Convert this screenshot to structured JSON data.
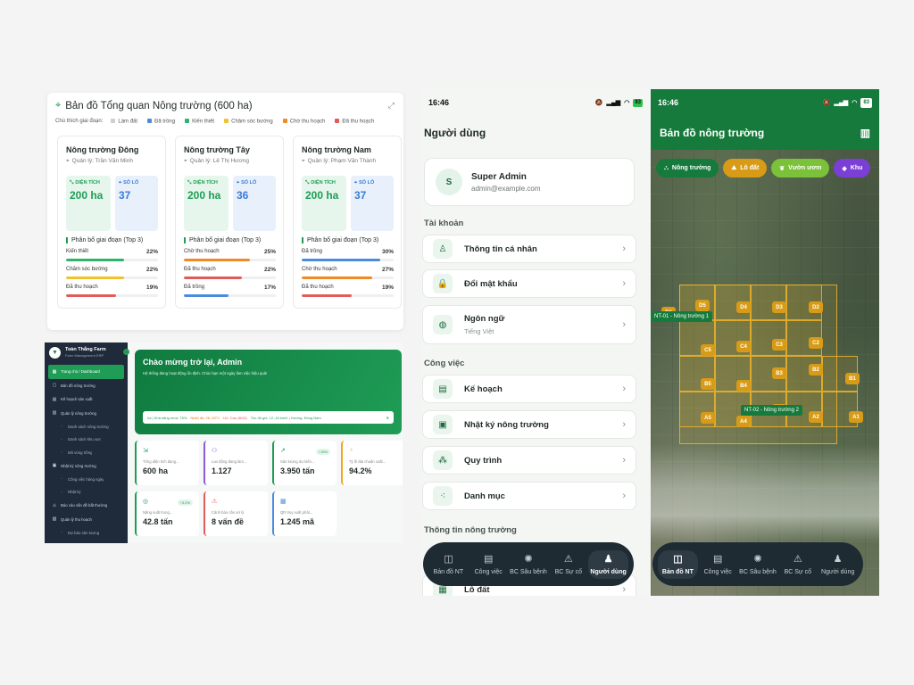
{
  "overview": {
    "title": "Bản đồ Tổng quan Nông trường (600 ha)",
    "legend_label": "Chú thích giai đoạn:",
    "legend": [
      {
        "label": "Làm đất",
        "color": "#c9cfd4"
      },
      {
        "label": "Đã trồng",
        "color": "#4a8be0"
      },
      {
        "label": "Kiến thiết",
        "color": "#2fb36a"
      },
      {
        "label": "Chăm sóc bướng",
        "color": "#f2c12e"
      },
      {
        "label": "Chờ thu hoạch",
        "color": "#f08a24"
      },
      {
        "label": "Đã thu hoạch",
        "color": "#e25b5b"
      }
    ],
    "farms": [
      {
        "name": "Nông trường Đông",
        "manager": "Quản lý: Trần Văn Minh",
        "area_label": "DIỆN TÍCH",
        "area": "200 ha",
        "plots_label": "SỐ LÔ",
        "plots": "37",
        "dist_title": "Phân bổ giai đoạn (Top 3)",
        "rows": [
          {
            "label": "Kiến thiết",
            "pct": "22%",
            "value": 22,
            "color": "#2fb36a"
          },
          {
            "label": "Chăm sóc bướng",
            "pct": "22%",
            "value": 22,
            "color": "#f2c12e"
          },
          {
            "label": "Đã thu hoạch",
            "pct": "19%",
            "value": 19,
            "color": "#e25b5b"
          }
        ]
      },
      {
        "name": "Nông trường Tây",
        "manager": "Quản lý: Lê Thị Hương",
        "area_label": "DIỆN TÍCH",
        "area": "200 ha",
        "plots_label": "SỐ LÔ",
        "plots": "36",
        "dist_title": "Phân bổ giai đoạn (Top 3)",
        "rows": [
          {
            "label": "Chờ thu hoạch",
            "pct": "25%",
            "value": 25,
            "color": "#f08a24"
          },
          {
            "label": "Đã thu hoạch",
            "pct": "22%",
            "value": 22,
            "color": "#e25b5b"
          },
          {
            "label": "Đã trồng",
            "pct": "17%",
            "value": 17,
            "color": "#4a8be0"
          }
        ]
      },
      {
        "name": "Nông trường Nam",
        "manager": "Quản lý: Phạm Văn Thành",
        "area_label": "DIỆN TÍCH",
        "area": "200 ha",
        "plots_label": "SỐ LÔ",
        "plots": "37",
        "dist_title": "Phân bổ giai đoạn (Top 3)",
        "rows": [
          {
            "label": "Đã trồng",
            "pct": "30%",
            "value": 30,
            "color": "#4a8be0"
          },
          {
            "label": "Chờ thu hoạch",
            "pct": "27%",
            "value": 27,
            "color": "#f08a24"
          },
          {
            "label": "Đã thu hoạch",
            "pct": "19%",
            "value": 19,
            "color": "#e25b5b"
          }
        ]
      }
    ]
  },
  "dashboard": {
    "brand": "Toàn Thắng Farm",
    "brand_sub": "Farm Management ERP",
    "menu": [
      {
        "label": "Trang chủ / Dashboard",
        "active": true,
        "sub": false,
        "icon": "▦"
      },
      {
        "label": "Bản đồ nông trường",
        "sub": false,
        "icon": "▢"
      },
      {
        "label": "Kế hoạch sản xuất",
        "sub": false,
        "icon": "▤"
      },
      {
        "label": "Quản lý nông trường",
        "sub": false,
        "icon": "▥"
      },
      {
        "label": "Danh sách nông trường",
        "sub": true,
        "icon": "·"
      },
      {
        "label": "Danh sách khu vực",
        "sub": true,
        "icon": "·"
      },
      {
        "label": "Mô vùng trồng",
        "sub": true,
        "icon": "·"
      },
      {
        "label": "Nhật ký nông trường",
        "sub": false,
        "icon": "▣"
      },
      {
        "label": "Công việc hàng ngày",
        "sub": true,
        "icon": "·"
      },
      {
        "label": "Nhật ký",
        "sub": true,
        "icon": "·"
      },
      {
        "label": "Báo cáo vấn đề bất thường",
        "sub": false,
        "icon": "⚠"
      },
      {
        "label": "Quản lý thu hoạch",
        "sub": false,
        "icon": "▧"
      },
      {
        "label": "Dự báo sản lượng",
        "sub": true,
        "icon": "·"
      }
    ],
    "welcome_title": "Chào mừng trở lại, Admin",
    "welcome_sub": "Hệ thống đang hoạt động ổn định. Chúc bạn một ngày làm việc hiệu quả!",
    "weather": {
      "humidity": "ha | Khả năng mưa: 75%",
      "temp": "Nhiệt độ: 26–33°C",
      "uv": "UV: Cao (8/10)",
      "wind": "Tốc độ gió: 12–18 km/h | Hướng: Đông Nam",
      "close": "✕"
    },
    "stats": [
      {
        "label": "Tổng diện tích đang...",
        "value": "600 ha",
        "tag": "",
        "color": "#1f9d56",
        "icon": "⇲"
      },
      {
        "label": "Lao động đang làm...",
        "value": "1.127",
        "tag": "",
        "color": "#8a5cd1",
        "icon": "⚇"
      },
      {
        "label": "Sản lượng dự kiến...",
        "value": "3.950 tấn",
        "tag": "+15%",
        "color": "#1f9d56",
        "icon": "↗"
      },
      {
        "label": "Tỷ lệ đạt chuẩn xuất...",
        "value": "94.2%",
        "tag": "",
        "color": "#f2a51e",
        "icon": "♁"
      },
      {
        "label": "Năng suất trung...",
        "value": "42.8 tấn",
        "tag": "+3.2%",
        "color": "#1f9d56",
        "icon": "◎"
      },
      {
        "label": "Cảnh báo cần xử lý",
        "value": "8 vấn đề",
        "tag": "",
        "color": "#e25b5b",
        "icon": "⚠"
      },
      {
        "label": "QR truy xuất phát...",
        "value": "1.245 mã",
        "tag": "",
        "color": "#4a8be0",
        "icon": "▦"
      }
    ]
  },
  "users_screen": {
    "time": "16:46",
    "battery": "83",
    "title": "Người dùng",
    "user_initial": "S",
    "user_name": "Super Admin",
    "user_email": "admin@example.com",
    "section_account": "Tài khoản",
    "account_items": [
      {
        "label": "Thông tin cá nhân",
        "icon": "user-icon",
        "glyph": "♙"
      },
      {
        "label": "Đổi mật khẩu",
        "icon": "lock-icon",
        "glyph": "🔒"
      },
      {
        "label": "Ngôn ngữ",
        "sub": "Tiếng Việt",
        "icon": "globe-icon",
        "glyph": "◍"
      }
    ],
    "section_work": "Công việc",
    "work_items": [
      {
        "label": "Kế hoạch",
        "icon": "calendar-icon",
        "glyph": "▤"
      },
      {
        "label": "Nhật ký nông trường",
        "icon": "journal-icon",
        "glyph": "▣"
      },
      {
        "label": "Quy trình",
        "icon": "workflow-icon",
        "glyph": "⁂"
      },
      {
        "label": "Danh mục",
        "icon": "category-icon",
        "glyph": "⁖"
      }
    ],
    "section_farm": "Thông tin nông trường",
    "farm_items": [
      {
        "label": "Lô đất",
        "icon": "grid-icon",
        "glyph": "▦"
      }
    ],
    "tabs": [
      {
        "label": "Bản đồ NT",
        "glyph": "◫"
      },
      {
        "label": "Công việc",
        "glyph": "▤"
      },
      {
        "label": "BC Sâu bệnh",
        "glyph": "✺"
      },
      {
        "label": "BC Sự cố",
        "glyph": "⚠"
      },
      {
        "label": "Người dùng",
        "glyph": "♟"
      }
    ],
    "active_tab": 4
  },
  "map_screen": {
    "time": "16:46",
    "battery": "83",
    "title": "Bản đồ nông trường",
    "chips": [
      {
        "label": "Nông trường",
        "color": "#157a3b",
        "glyph": "⛬"
      },
      {
        "label": "Lô đất",
        "color": "#d79b17",
        "glyph": "⛰"
      },
      {
        "label": "Vườn ươm",
        "color": "#7cc13a",
        "glyph": "❦"
      },
      {
        "label": "Khu",
        "color": "#7b3fd6",
        "glyph": "◈"
      }
    ],
    "farm_labels": [
      {
        "label": "NT-01 - Nông trường 1"
      },
      {
        "label": "NT-02 - Nông trường 2"
      }
    ],
    "plots": [
      "D6",
      "D5",
      "D4",
      "D3",
      "D2",
      "C5",
      "C4",
      "C3",
      "C2",
      "B5",
      "B4",
      "B3",
      "B2",
      "B1",
      "A5",
      "A4",
      "A3",
      "A2",
      "A1"
    ],
    "tabs": [
      {
        "label": "Bản đồ NT",
        "glyph": "◫"
      },
      {
        "label": "Công việc",
        "glyph": "▤"
      },
      {
        "label": "BC Sâu bệnh",
        "glyph": "✺"
      },
      {
        "label": "BC Sự cố",
        "glyph": "⚠"
      },
      {
        "label": "Người dùng",
        "glyph": "♟"
      }
    ],
    "active_tab": 0
  }
}
